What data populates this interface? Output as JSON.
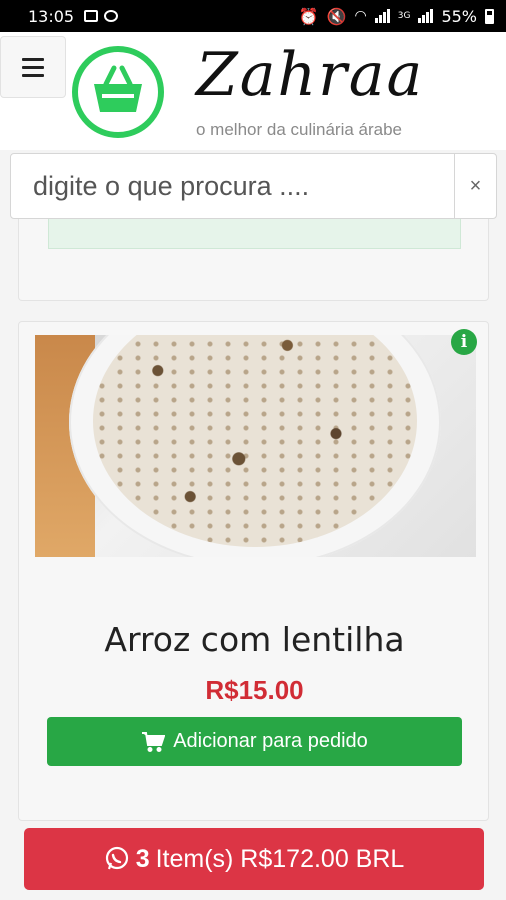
{
  "status_bar": {
    "time": "13:05",
    "battery": "55%",
    "network_label": "3G"
  },
  "header": {
    "brand": "Zahraa",
    "tagline": "o melhor da culinária árabe",
    "logo_color": "#2ecc5c"
  },
  "search": {
    "placeholder": "digite o que procura ....",
    "clear_label": "×"
  },
  "product": {
    "name": "Arroz com lentilha",
    "price": "R$15.00",
    "add_label": "Adicionar para pedido",
    "info_label": "i",
    "image_desc_icon": "rice-with-lentils-photo"
  },
  "cart": {
    "count": "3",
    "label": "Item(s) R$172.00 BRL",
    "color": "#dc3545"
  },
  "colors": {
    "accent_green": "#28a745",
    "price_red": "#d12c35"
  }
}
